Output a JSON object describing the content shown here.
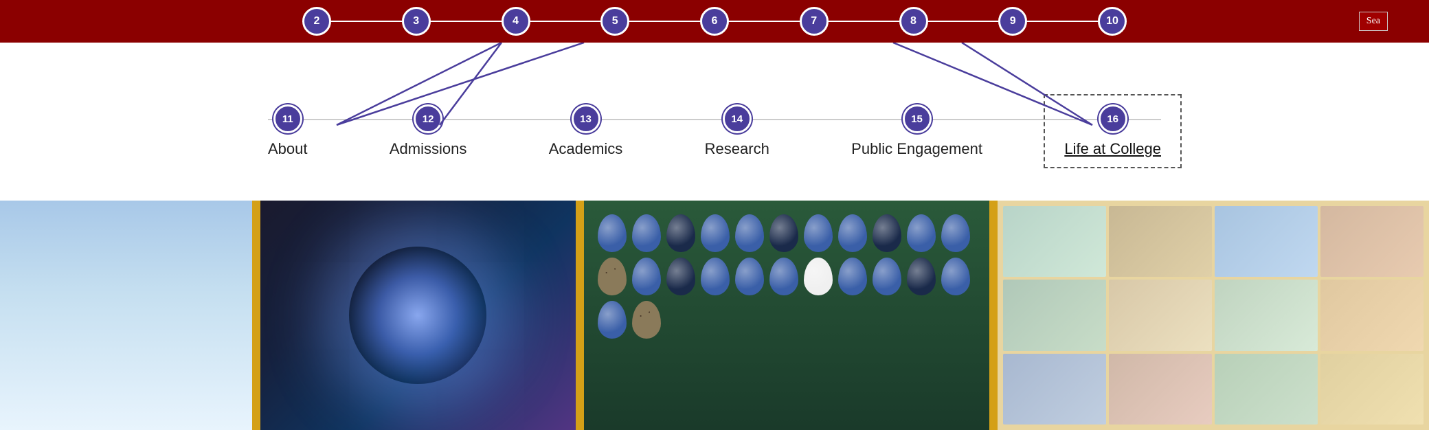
{
  "topBar": {
    "backgroundColor": "#8b0000",
    "nodes": [
      {
        "id": "node-2",
        "label": "2"
      },
      {
        "id": "node-3",
        "label": "3"
      },
      {
        "id": "node-4",
        "label": "4"
      },
      {
        "id": "node-5",
        "label": "5"
      },
      {
        "id": "node-6",
        "label": "6"
      },
      {
        "id": "node-7",
        "label": "7"
      },
      {
        "id": "node-8",
        "label": "8"
      },
      {
        "id": "node-9",
        "label": "9"
      },
      {
        "id": "node-10",
        "label": "10"
      }
    ],
    "searchLabel": "Sea"
  },
  "navBar": {
    "items": [
      {
        "id": "node-11",
        "label": "11",
        "text": "About"
      },
      {
        "id": "node-12",
        "label": "12",
        "text": "Admissions"
      },
      {
        "id": "node-13",
        "label": "13",
        "text": "Academics"
      },
      {
        "id": "node-14",
        "label": "14",
        "text": "Research"
      },
      {
        "id": "node-15",
        "label": "15",
        "text": "Public Engagement"
      },
      {
        "id": "node-16",
        "label": "16",
        "text": "Life at College",
        "highlighted": true
      }
    ]
  },
  "images": {
    "panels": [
      "sky",
      "dark-glow",
      "eggs",
      "museum"
    ]
  }
}
